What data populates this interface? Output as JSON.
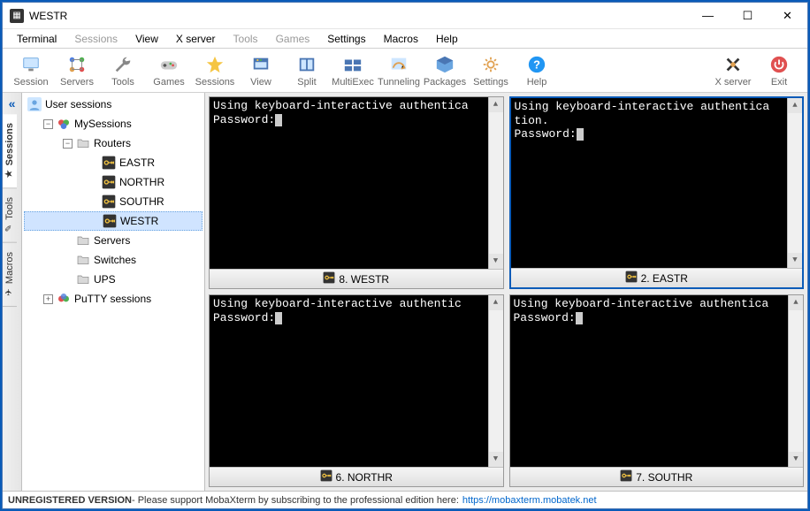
{
  "window": {
    "title": "WESTR"
  },
  "menu": {
    "items": [
      {
        "label": "Terminal",
        "disabled": false
      },
      {
        "label": "Sessions",
        "disabled": true
      },
      {
        "label": "View",
        "disabled": false
      },
      {
        "label": "X server",
        "disabled": false
      },
      {
        "label": "Tools",
        "disabled": true
      },
      {
        "label": "Games",
        "disabled": true
      },
      {
        "label": "Settings",
        "disabled": false
      },
      {
        "label": "Macros",
        "disabled": false
      },
      {
        "label": "Help",
        "disabled": false
      }
    ]
  },
  "toolbar": {
    "items": [
      {
        "name": "session",
        "label": "Session",
        "icon": "monitor"
      },
      {
        "name": "servers",
        "label": "Servers",
        "icon": "servers"
      },
      {
        "name": "tools",
        "label": "Tools",
        "icon": "wrench"
      },
      {
        "name": "games",
        "label": "Games",
        "icon": "gamepad"
      },
      {
        "name": "sessions",
        "label": "Sessions",
        "icon": "star"
      },
      {
        "name": "view",
        "label": "View",
        "icon": "view"
      },
      {
        "name": "split",
        "label": "Split",
        "icon": "split"
      },
      {
        "name": "multiexec",
        "label": "MultiExec",
        "icon": "multi"
      },
      {
        "name": "tunneling",
        "label": "Tunneling",
        "icon": "tunnel"
      },
      {
        "name": "packages",
        "label": "Packages",
        "icon": "package"
      },
      {
        "name": "settings",
        "label": "Settings",
        "icon": "gear"
      },
      {
        "name": "help",
        "label": "Help",
        "icon": "help"
      }
    ],
    "right": [
      {
        "name": "xserver",
        "label": "X server",
        "icon": "xserver"
      },
      {
        "name": "exit",
        "label": "Exit",
        "icon": "power"
      }
    ]
  },
  "vtabs": {
    "items": [
      {
        "name": "sessions",
        "label": "Sessions",
        "active": true
      },
      {
        "name": "tools",
        "label": "Tools",
        "active": false
      },
      {
        "name": "macros",
        "label": "Macros",
        "active": false
      }
    ]
  },
  "tree": {
    "root": {
      "label": "User sessions"
    },
    "mysessions": {
      "label": "MySessions"
    },
    "routers": {
      "label": "Routers"
    },
    "leaves": [
      {
        "label": "EASTR"
      },
      {
        "label": "NORTHR"
      },
      {
        "label": "SOUTHR"
      },
      {
        "label": "WESTR"
      }
    ],
    "servers": {
      "label": "Servers"
    },
    "switches": {
      "label": "Switches"
    },
    "ups": {
      "label": "UPS"
    },
    "putty": {
      "label": "PuTTY sessions"
    }
  },
  "terminals": [
    {
      "tab": "8. WESTR",
      "content": "Using keyboard-interactive authentica\nPassword:",
      "active": false
    },
    {
      "tab": "2. EASTR",
      "content": "Using keyboard-interactive authentica\ntion.\nPassword:",
      "active": true
    },
    {
      "tab": "6. NORTHR",
      "content": "Using keyboard-interactive authentic\nPassword:",
      "active": false
    },
    {
      "tab": "7. SOUTHR",
      "content": "Using keyboard-interactive authentica\nPassword:",
      "active": false
    }
  ],
  "status": {
    "bold": "UNREGISTERED VERSION",
    "text": " -  Please support MobaXterm by subscribing to the professional edition here:  ",
    "link": "https://mobaxterm.mobatek.net"
  }
}
